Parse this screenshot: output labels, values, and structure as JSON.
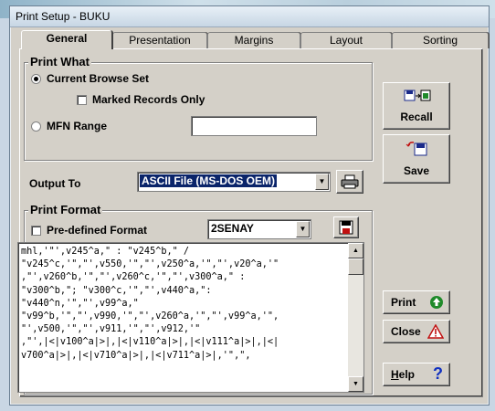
{
  "window": {
    "title": "Print Setup - BUKU"
  },
  "tabs": [
    {
      "label": "General",
      "active": true
    },
    {
      "label": "Presentation",
      "active": false
    },
    {
      "label": "Margins",
      "active": false
    },
    {
      "label": "Layout",
      "active": false
    },
    {
      "label": "Sorting",
      "active": false
    }
  ],
  "print_what": {
    "title": "Print What",
    "current_browse_set": "Current Browse Set",
    "marked_records_only": "Marked Records Only",
    "mfn_range": "MFN Range",
    "mfn_range_value": ""
  },
  "output": {
    "label": "Output To",
    "selected": "ASCII File (MS-DOS OEM)"
  },
  "print_format": {
    "title": "Print Format",
    "predefined_label": "Pre-defined Format",
    "format_selected": "2SENAY",
    "code_lines": [
      "mhl,'\"',v245^a,\" : \"v245^b,\" /",
      "\"v245^c,'\",\"',v550,'\",\"',v250^a,'\",\"',v20^a,'\"",
      ",\"',v260^b,'\",\"',v260^c,'\",\"',v300^a,\" :",
      "\"v300^b,\"; \"v300^c,'\",\"',v440^a,\":",
      "\"v440^n,'\",\"',v99^a,\"",
      "\"v99^b,'\",\"',v990,'\",\"',v260^a,'\",\"',v99^a,'\",",
      "\"',v500,'\",\"',v911,'\",\"',v912,'\"",
      ",\"',|<|v100^a|>|,|<|v110^a|>|,|<|v111^a|>|,|<|",
      "v700^a|>|,|<|v710^a|>|,|<|v711^a|>|,'\",\","
    ]
  },
  "buttons": {
    "recall": "Recall",
    "save": "Save",
    "print": "Print",
    "close": "Close",
    "help": "Help",
    "help_accel": "H",
    "help_rest": "elp"
  },
  "colors": {
    "print_icon": "#1f8a2a",
    "close_icon": "#c01010",
    "help_icon": "#1030c0",
    "selection": "#0a246a"
  }
}
